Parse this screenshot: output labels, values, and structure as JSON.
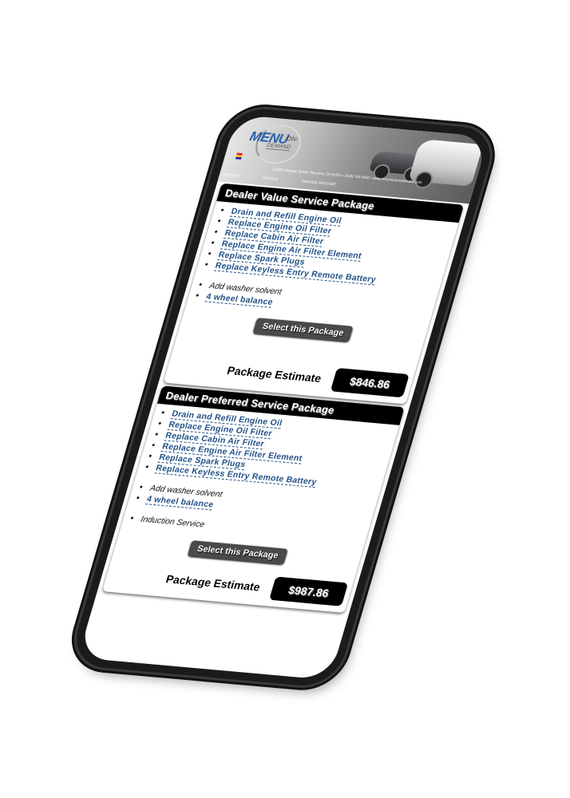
{
  "header": {
    "logo_main": "MENU",
    "logo_on": "ON-",
    "logo_demand": "DEMAND",
    "address": "12558 Vantage Street, Pacoima, CA 91331 • (818) 764-3600 • www.mscmenuondemand.com",
    "tabs": [
      {
        "label": "ADVISOR"
      },
      {
        "label": "VEHICLE"
      },
      {
        "label": "SERVICE PACKAGE"
      }
    ]
  },
  "packages": [
    {
      "title": "Dealer Value Service Package",
      "services": [
        "Drain and Refill Engine Oil",
        "Replace Engine Oil Filter",
        "Replace Cabin Air Filter",
        "Replace Engine Air Filter Element",
        "Replace Spark Plugs",
        "Replace Keyless Entry Remote Battery"
      ],
      "extras": [
        {
          "label": "Add washer solvent",
          "link": false
        },
        {
          "label": "4 wheel balance",
          "link": true
        }
      ],
      "select_label": "Select this Package",
      "estimate_label": "Package Estimate",
      "estimate_value": "$846.86"
    },
    {
      "title": "Dealer Preferred Service Package",
      "services": [
        "Drain and Refill Engine Oil",
        "Replace Engine Oil Filter",
        "Replace Cabin Air Filter",
        "Replace Engine Air Filter Element",
        "Replace Spark Plugs",
        "Replace Keyless Entry Remote Battery"
      ],
      "extras": [
        {
          "label": "Add washer solvent",
          "link": false
        },
        {
          "label": "4 wheel balance",
          "link": true
        }
      ],
      "additional": [
        {
          "label": "Induction Service",
          "link": false
        }
      ],
      "select_label": "Select this Package",
      "estimate_label": "Package Estimate",
      "estimate_value": "$987.86"
    }
  ],
  "colors": {
    "link": "#1f4f86",
    "title_bar": "#000000",
    "button": "#4a4a4a",
    "logo": "#2a5fa8"
  }
}
